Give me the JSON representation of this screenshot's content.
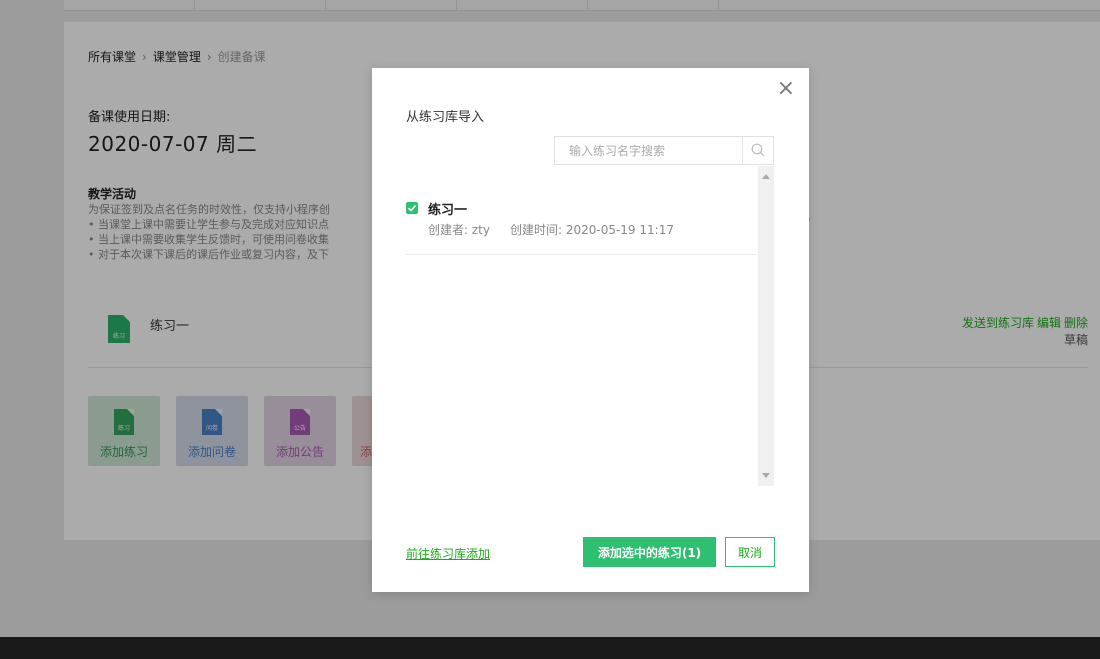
{
  "breadcrumb": {
    "items": [
      "所有课堂",
      "课堂管理",
      "创建备课"
    ],
    "separator": "›"
  },
  "lesson": {
    "date_label": "备课使用日期:",
    "date_value": "2020-07-07 周二",
    "activity_title": "教学活动",
    "activity_lines": [
      "为保证签到及点名任务的时效性，仅支持小程序创",
      "• 当课堂上课中需要让学生参与及完成对应知识点",
      "• 当上课中需要收集学生反馈时，可使用问卷收集",
      "• 对于本次课下课后的课后作业或复习内容，及下"
    ],
    "activity_tail": "。"
  },
  "exercise_row": {
    "icon_text": "练习",
    "name": "练习一",
    "actions": [
      "发送到练习库",
      "编辑",
      "删除"
    ],
    "status": "草稿"
  },
  "add_tiles": [
    {
      "icon_text": "练习",
      "label": "添加练习"
    },
    {
      "icon_text": "问卷",
      "label": "添加问卷"
    },
    {
      "icon_text": "公告",
      "label": "添加公告"
    },
    {
      "icon_text": "",
      "label": "添"
    }
  ],
  "modal": {
    "title": "从练习库导入",
    "close_symbol": "×",
    "search_placeholder": "输入练习名字搜索",
    "items": [
      {
        "title": "练习一",
        "checked": true,
        "creator": "创建者: zty",
        "created_at": "创建时间: 2020-05-19 11:17"
      }
    ],
    "goto_link": "前往练习库添加",
    "confirm_button": "添加选中的练习(1)",
    "cancel_button": "取消"
  },
  "colors": {
    "accent_green": "#2fbf71",
    "link_green": "#1aad19",
    "overlay": "rgba(0,0,0,0.33)"
  }
}
